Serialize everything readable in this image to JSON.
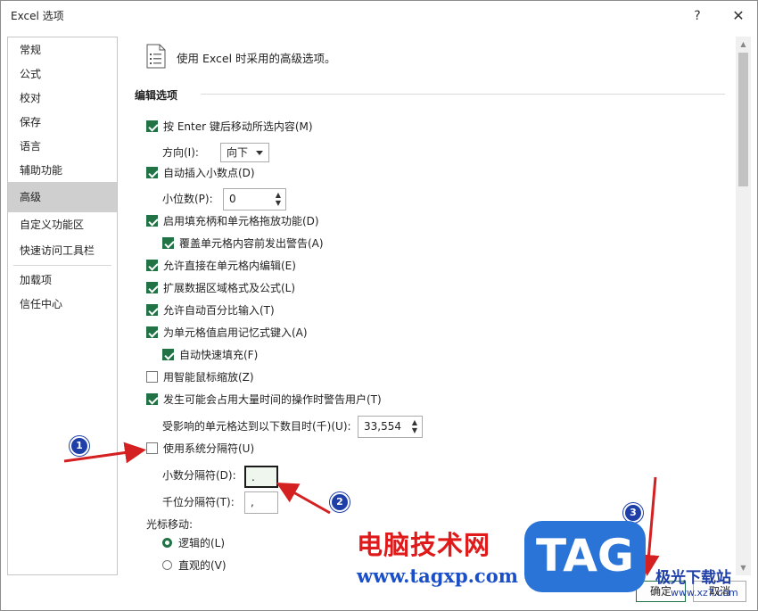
{
  "window": {
    "title": "Excel 选项",
    "help": "?",
    "close": "✕"
  },
  "sidebar": {
    "items": [
      "常规",
      "公式",
      "校对",
      "保存",
      "语言",
      "辅助功能",
      "高级",
      "自定义功能区",
      "快速访问工具栏",
      "加载项",
      "信任中心"
    ],
    "active_index": 6
  },
  "content": {
    "headline": "使用 Excel 时采用的高级选项。",
    "section_title": "编辑选项",
    "opt_enter_move": {
      "label": "按 Enter 键后移动所选内容(M)",
      "checked": true
    },
    "direction": {
      "label": "方向(I):",
      "value": "向下"
    },
    "opt_auto_decimal": {
      "label": "自动插入小数点(D)",
      "checked": true
    },
    "decimal_places": {
      "label": "小位数(P):",
      "value": "0"
    },
    "opt_fill_handle": {
      "label": "启用填充柄和单元格拖放功能(D)",
      "checked": true
    },
    "opt_overwrite_alert": {
      "label": "覆盖单元格内容前发出警告(A)",
      "checked": true
    },
    "opt_edit_in_cell": {
      "label": "允许直接在单元格内编辑(E)",
      "checked": true
    },
    "opt_extend_formats": {
      "label": "扩展数据区域格式及公式(L)",
      "checked": true
    },
    "opt_auto_percent": {
      "label": "允许自动百分比输入(T)",
      "checked": true
    },
    "opt_autocomplete": {
      "label": "为单元格值启用记忆式键入(A)",
      "checked": true
    },
    "opt_flash_fill": {
      "label": "自动快速填充(F)",
      "checked": true
    },
    "opt_intellimouse_zoom": {
      "label": "用智能鼠标缩放(Z)",
      "checked": false
    },
    "opt_alert_time_consuming": {
      "label": "发生可能会占用大量时间的操作时警告用户(T)",
      "checked": true
    },
    "cells_affected": {
      "label": "受影响的单元格达到以下数目时(千)(U):",
      "value": "33,554"
    },
    "opt_system_separators": {
      "label": "使用系统分隔符(U)",
      "checked": false
    },
    "decimal_separator": {
      "label": "小数分隔符(D):",
      "value": "."
    },
    "thousands_separator": {
      "label": "千位分隔符(T):",
      "value": ","
    },
    "cursor_movement": {
      "label": "光标移动:"
    },
    "radio_logical": {
      "label": "逻辑的(L)",
      "selected": true
    },
    "radio_visual": {
      "label": "直观的(V)",
      "selected": false
    }
  },
  "buttons": {
    "ok": "确定",
    "cancel": "取消"
  },
  "annotations": [
    "1",
    "2",
    "3"
  ],
  "watermark": {
    "cn_text": "电脑技术网",
    "url": "www.tagxp.com",
    "tag": "TAG",
    "site2": "极光下载站",
    "site2_url": "www.xz7.com"
  },
  "colors": {
    "accent": "#217346",
    "annotation": "#1e3fa8",
    "arrow": "#d42020",
    "watermark_red": "#e01a1a",
    "tag_blue": "#2a74d8"
  }
}
